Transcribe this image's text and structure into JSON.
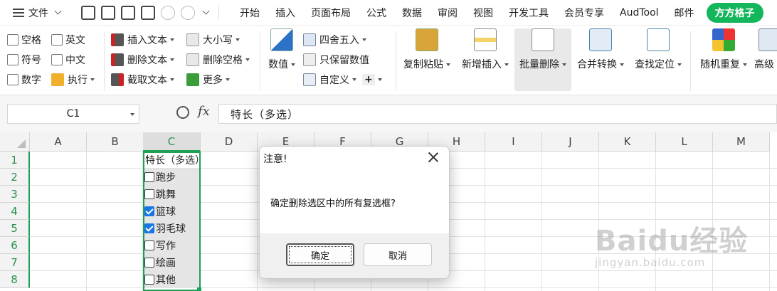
{
  "menubar": {
    "file_label": "文件",
    "tabs": [
      "开始",
      "插入",
      "页面布局",
      "公式",
      "数据",
      "审阅",
      "视图",
      "开发工具",
      "会员专享",
      "AudTool",
      "邮件"
    ],
    "highlight_tab": "方方格子"
  },
  "ribbon": {
    "checkbox_group": {
      "items": [
        "空格",
        "英文",
        "符号",
        "中文",
        "数字"
      ],
      "execute": "执行"
    },
    "text_group": {
      "insert": "插入文本",
      "delete": "删除文本",
      "extract": "截取文本"
    },
    "case_group": {
      "case": "大小写",
      "remove_space": "删除空格",
      "more": "更多"
    },
    "number_group": {
      "numeric": "数值",
      "round": "四舍五入",
      "keep_numeric": "只保留数值",
      "custom": "自定义"
    },
    "big_buttons": [
      "复制粘贴",
      "新增插入",
      "批量删除",
      "合并转换",
      "查找定位",
      "随机重复",
      "高级"
    ]
  },
  "formula_bar": {
    "name_box": "C1",
    "fx": "fx",
    "content": "特长（多选）"
  },
  "grid": {
    "columns": [
      "A",
      "B",
      "C",
      "D",
      "E",
      "F",
      "G",
      "H",
      "I",
      "J",
      "K",
      "L",
      "M"
    ],
    "rows": [
      "1",
      "2",
      "3",
      "4",
      "5",
      "6",
      "7",
      "8"
    ],
    "c1_header": "特长（多选）",
    "items": [
      {
        "label": "跑步",
        "checked": false
      },
      {
        "label": "跳舞",
        "checked": false
      },
      {
        "label": "篮球",
        "checked": true
      },
      {
        "label": "羽毛球",
        "checked": true
      },
      {
        "label": "写作",
        "checked": false
      },
      {
        "label": "绘画",
        "checked": false
      },
      {
        "label": "其他",
        "checked": false
      }
    ]
  },
  "dialog": {
    "title": "注意!",
    "message": "确定删除选区中的所有复选框?",
    "ok": "确定",
    "cancel": "取消"
  },
  "watermark": {
    "line1": "Baidu经验",
    "line2": "jingyan.baidu.com"
  },
  "colors": {
    "accent": "#20a055",
    "pill": "#13b65a",
    "checkbox_on": "#1877e4"
  }
}
